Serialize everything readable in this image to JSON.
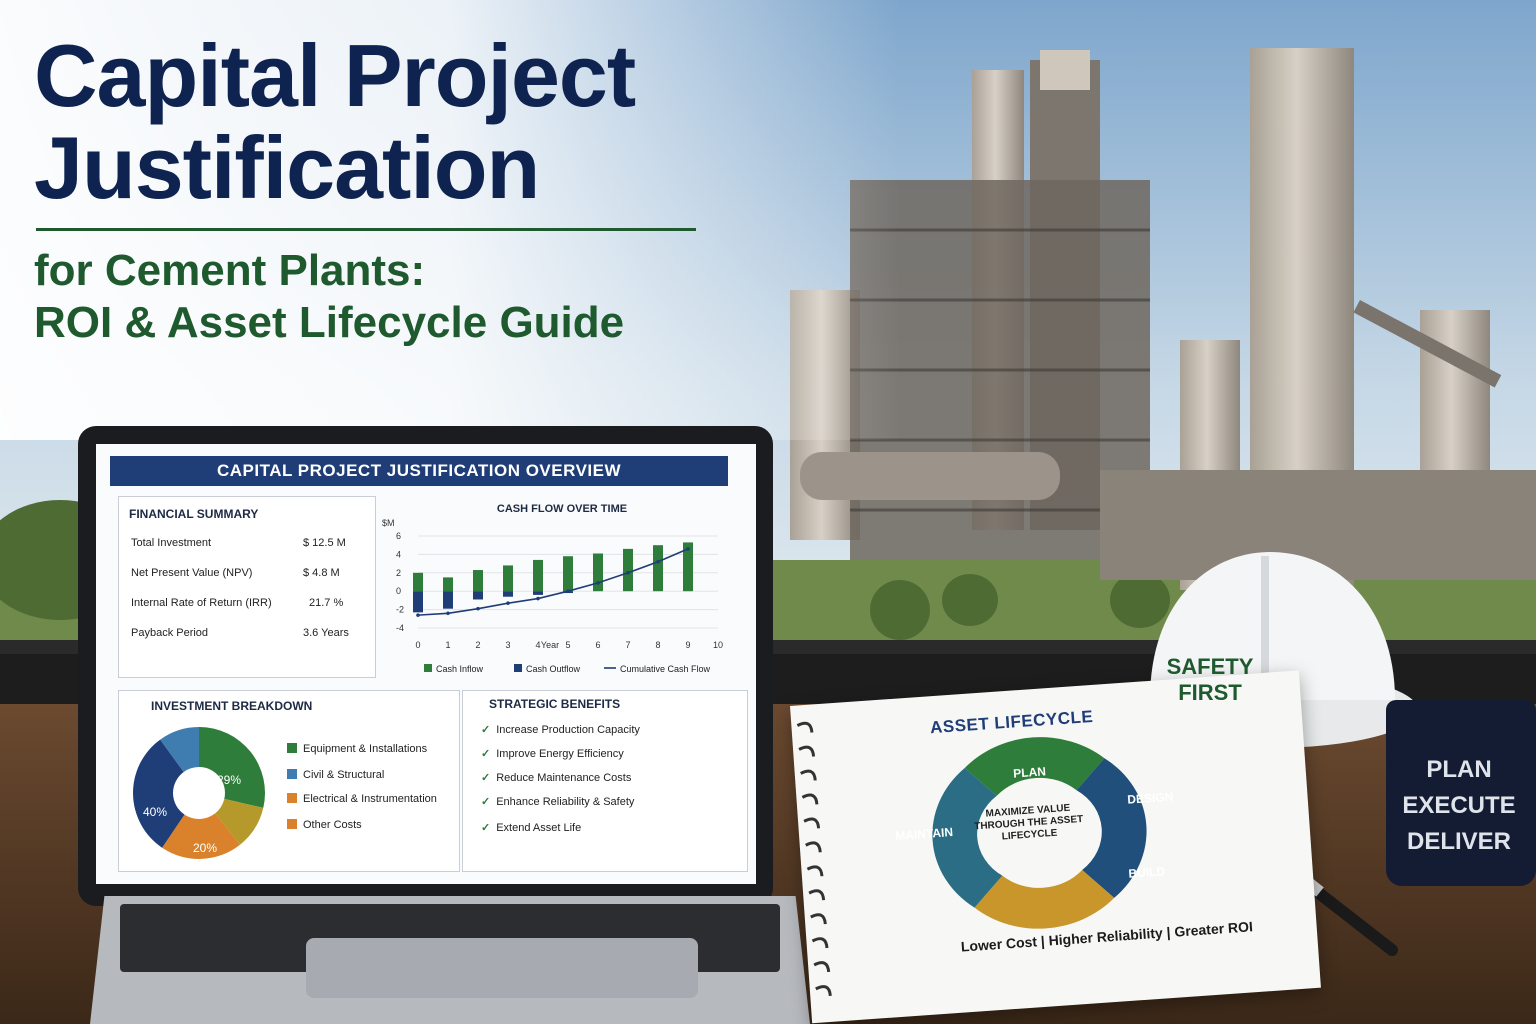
{
  "headline": {
    "title_line1": "Capital Project",
    "title_line2": "Justification",
    "subtitle_line1": "for Cement Plants:",
    "subtitle_line2": "ROI & Asset Lifecycle Guide"
  },
  "laptop": {
    "overview_title": "CAPITAL PROJECT JUSTIFICATION OVERVIEW",
    "financial_summary": {
      "heading": "FINANCIAL SUMMARY",
      "rows": [
        {
          "label": "Total Investment",
          "value": "$ 12.5 M"
        },
        {
          "label": "Net Present Value (NPV)",
          "value": "$  4.8 M"
        },
        {
          "label": "Internal Rate of Return (IRR)",
          "value": "21.7 %"
        },
        {
          "label": "Payback Period",
          "value": "3.6 Years"
        }
      ]
    },
    "investment_breakdown": {
      "heading": "INVESTMENT BREAKDOWN",
      "legend": [
        "Equipment & Installations",
        "Civil & Structural",
        "Electrical & Instrumentation",
        "Other Costs"
      ],
      "slice_labels": [
        "29%",
        "40%",
        "20%"
      ]
    },
    "strategic_benefits": {
      "heading": "STRATEGIC BENEFITS",
      "items": [
        "Increase Production Capacity",
        "Improve Energy Efficiency",
        "Reduce Maintenance Costs",
        "Enhance Reliability & Safety",
        "Extend Asset Life"
      ]
    }
  },
  "chart_data": {
    "type": "bar",
    "title": "CASH FLOW OVER TIME",
    "ylabel": "$M",
    "xlabel": "Year",
    "ylim": [
      -4,
      6
    ],
    "yticks": [
      "6",
      "4",
      "2",
      "0",
      "-2",
      "-4"
    ],
    "categories": [
      "0",
      "1",
      "2",
      "3",
      "4",
      "5",
      "6",
      "7",
      "8",
      "9",
      "10"
    ],
    "series": [
      {
        "name": "Cash Inflow",
        "color": "#2e7d3a",
        "values": [
          2.0,
          1.5,
          2.3,
          2.8,
          3.4,
          3.8,
          4.1,
          4.6,
          5.0,
          5.3
        ]
      },
      {
        "name": "Cash Outflow",
        "color": "#1f3d77",
        "values": [
          -2.3,
          -1.9,
          -0.9,
          -0.6,
          -0.4,
          -0.2,
          0,
          0,
          0,
          0
        ]
      },
      {
        "name": "Cumulative Cash Flow",
        "color": "#1f3d77",
        "type": "line",
        "values": [
          -2.6,
          -2.4,
          -1.9,
          -1.3,
          -0.8,
          0,
          0.9,
          2.0,
          3.2,
          4.6
        ]
      }
    ]
  },
  "notebook": {
    "title": "ASSET LIFECYCLE",
    "center_text": "MAXIMIZE VALUE THROUGH THE ASSET LIFECYCLE",
    "stages": [
      "PLAN",
      "DESIGN",
      "BUILD",
      "MAINTAIN"
    ],
    "footer": "Lower Cost | Higher Reliability | Greater ROI"
  },
  "hard_hat": {
    "text": "SAFETY FIRST"
  },
  "mug": {
    "line1": "PLAN",
    "line2": "EXECUTE",
    "line3": "DELIVER"
  },
  "colors": {
    "navy": "#0f2350",
    "green": "#1e5a2e",
    "accent_blue": "#1f3d77",
    "gold": "#c8962a",
    "orange": "#d9822b"
  }
}
